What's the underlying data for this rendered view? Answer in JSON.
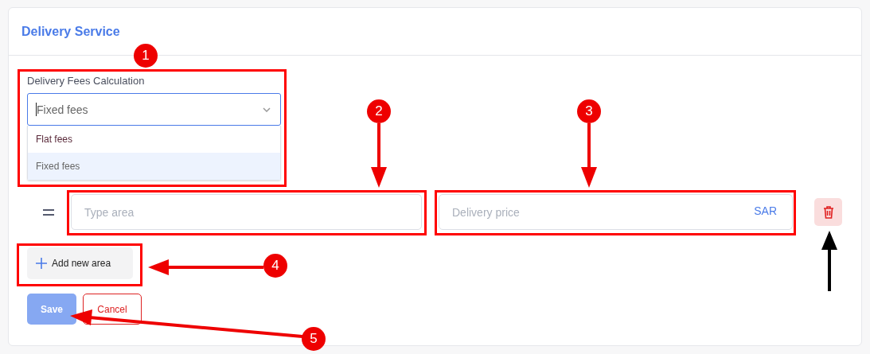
{
  "card": {
    "title": "Delivery Service"
  },
  "fees": {
    "label": "Delivery Fees Calculation",
    "value": "Fixed fees",
    "expanded": true,
    "options": [
      {
        "label": "Flat fees",
        "selected": false
      },
      {
        "label": "Fixed fees",
        "selected": true
      }
    ]
  },
  "areas": [
    {
      "area_placeholder": "Type area",
      "price_placeholder": "Delivery price",
      "currency": "SAR"
    }
  ],
  "add_button": "Add new area",
  "buttons": [
    {
      "label": "Save",
      "kind": "primary",
      "disabled": true
    },
    {
      "label": "Cancel",
      "kind": "outline",
      "disabled": false
    }
  ],
  "callouts": [
    "1",
    "2",
    "3",
    "4",
    "5"
  ]
}
